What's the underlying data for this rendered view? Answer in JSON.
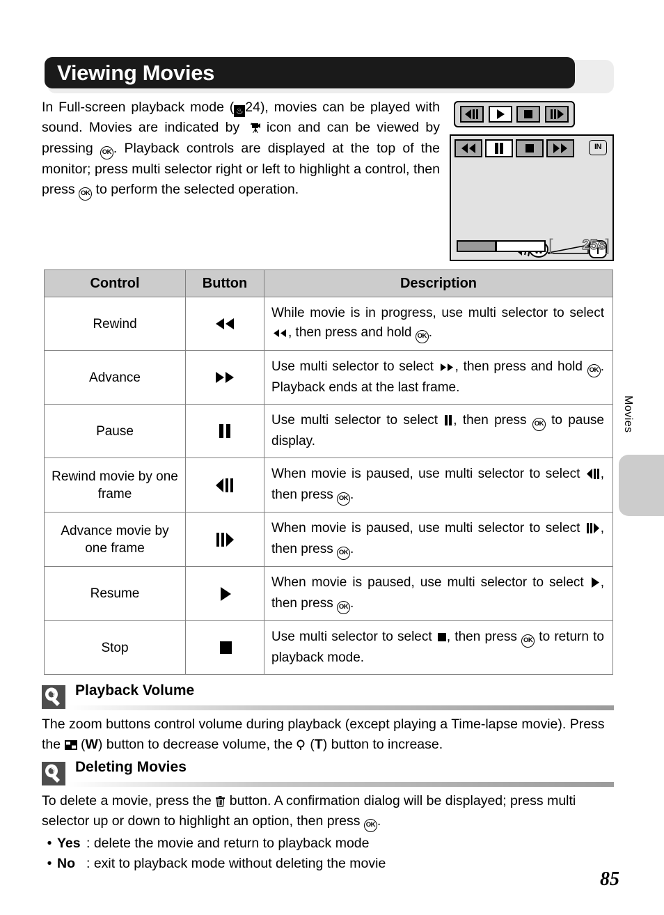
{
  "page": {
    "number": "85",
    "side_tab_label": "Movies"
  },
  "header": {
    "title": "Viewing Movies"
  },
  "intro": {
    "line1_a": "In  Full-screen  playback  mode  (",
    "page_ref": "24",
    "line1_b": "),  movies  can  be played with sound. Movies are indicated by ",
    "line1_c": " icon and can be viewed by pressing ",
    "ok": "OK",
    "line1_d": ". Playback controls are displayed at the top of the monitor; press multi selector right or left to highlight a control, then press ",
    "line1_e": " to perform the selected operation."
  },
  "illustration": {
    "callout_buttons": [
      {
        "name": "rewind-one-frame",
        "glyph": "prev-frame",
        "selected": false
      },
      {
        "name": "play",
        "glyph": "play",
        "selected": true
      },
      {
        "name": "stop",
        "glyph": "stop",
        "selected": false
      },
      {
        "name": "advance-one-frame",
        "glyph": "next-frame",
        "selected": false
      }
    ],
    "monitor_buttons": [
      {
        "name": "rewind",
        "glyph": "rewind",
        "selected": false
      },
      {
        "name": "pause",
        "glyph": "pause",
        "selected": true
      },
      {
        "name": "stop",
        "glyph": "stop",
        "selected": false
      },
      {
        "name": "advance",
        "glyph": "fast-forward",
        "selected": false
      }
    ],
    "memory_badge": "IN",
    "zoom_wide_label": "W",
    "zoom_tele_label": "T",
    "time_remaining": "25s",
    "progress_percent": 45
  },
  "table": {
    "headers": [
      "Control",
      "Button",
      "Description"
    ],
    "rows": [
      {
        "control": "Rewind",
        "button_glyph": "rewind",
        "desc_a": "While  movie  is  in  progress,  use  multi  selector  to select ",
        "desc_glyph": "rewind",
        "desc_b": ", then press and hold ",
        "ok": "OK",
        "desc_c": "."
      },
      {
        "control": "Advance",
        "button_glyph": "fast-forward",
        "desc_a": "Use multi selector to select ",
        "desc_glyph": "fast-forward",
        "desc_b": ", then press and hold ",
        "ok": "OK",
        "desc_c": ". Playback ends at the last frame."
      },
      {
        "control": "Pause",
        "button_glyph": "pause",
        "desc_a": "Use multi selector to select ",
        "desc_glyph": "pause",
        "desc_b": ", then press ",
        "ok": "OK",
        "desc_c": " to pause display."
      },
      {
        "control": "Rewind movie by one frame",
        "button_glyph": "prev-frame",
        "desc_a": "When movie is paused, use multi selector to select ",
        "desc_glyph": "prev-frame",
        "desc_b": ", then press ",
        "ok": "OK",
        "desc_c": "."
      },
      {
        "control": "Advance movie by one frame",
        "button_glyph": "next-frame",
        "desc_a": "When movie is paused, use multi selector to select ",
        "desc_glyph": "next-frame",
        "desc_b": ", then press ",
        "ok": "OK",
        "desc_c": "."
      },
      {
        "control": "Resume",
        "button_glyph": "play",
        "desc_a": "When movie is paused, use multi selector to select ",
        "desc_glyph": "play",
        "desc_b": ", then press ",
        "ok": "OK",
        "desc_c": "."
      },
      {
        "control": "Stop",
        "button_glyph": "stop",
        "desc_a": "Use  multi  selector  to  select ",
        "desc_glyph": "stop",
        "desc_b": ",  then  press ",
        "ok": "OK",
        "desc_c": " to return to playback mode."
      }
    ]
  },
  "notes": [
    {
      "title": "Playback Volume",
      "body_a": "The zoom buttons control volume during playback (except playing a Time-lapse movie). Press the ",
      "body_b": " (",
      "wide_key": "W",
      "body_c": ") button to decrease volume, the ",
      "body_d": " (",
      "tele_key": "T",
      "body_e": ") button to increase."
    },
    {
      "title": "Deleting Movies",
      "body_a": "To delete a movie, press the ",
      "body_b": " button. A confirmation dialog will be displayed; press multi selector up or down to highlight an option, then press ",
      "ok": "OK",
      "body_c": ".",
      "bullets": [
        {
          "key": "Yes",
          "text": ": delete the movie and return to playback mode"
        },
        {
          "key": "No",
          "text": ": exit to playback mode without deleting the movie"
        }
      ]
    }
  ],
  "colors": {
    "banner_bg": "#1a1a1a",
    "banner_back": "#ededed",
    "table_header_bg": "#cccccc",
    "table_border": "#808080",
    "monitor_bg": "#e2e2e2",
    "button_bg": "#a8a8a8",
    "side_tab_bg": "#cccccc",
    "note_icon_bg": "#4d4d4d"
  }
}
